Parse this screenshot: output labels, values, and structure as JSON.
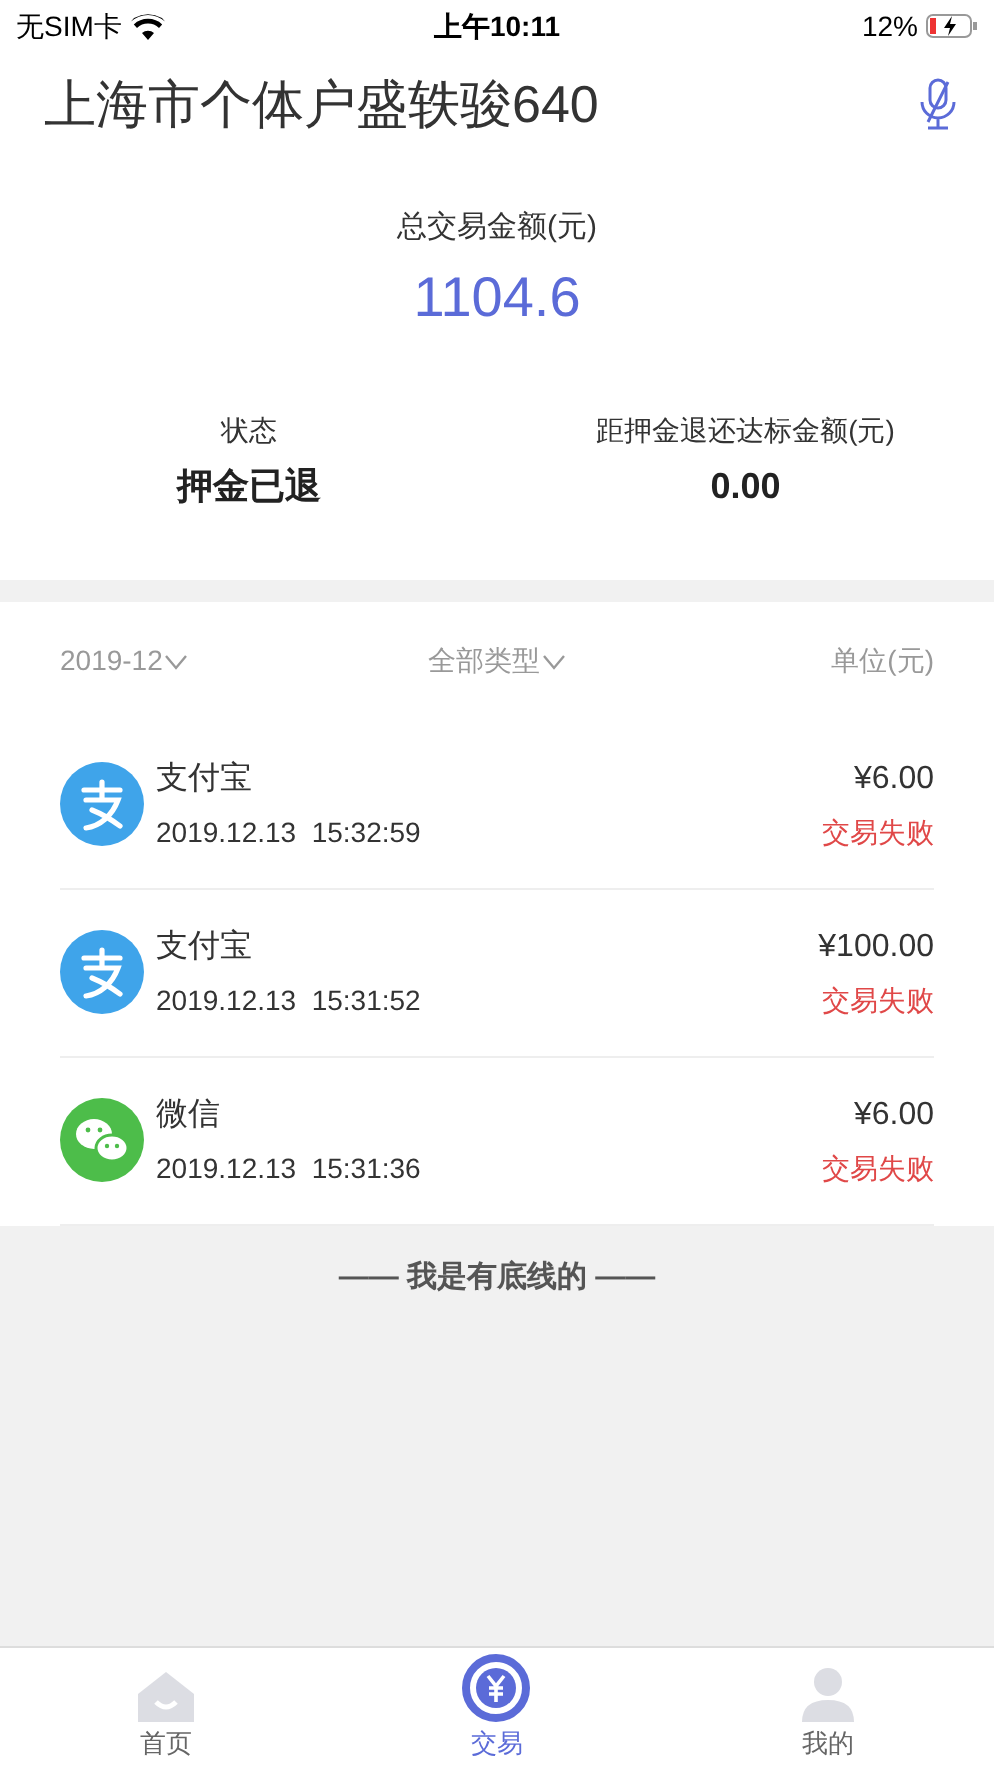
{
  "status_bar": {
    "carrier": "无SIM卡",
    "time": "上午10:11",
    "battery": "12%"
  },
  "header": {
    "title": "上海市个体户盛轶骏640"
  },
  "summary": {
    "total_label": "总交易金额(元)",
    "total_value": "1104.6",
    "stats": [
      {
        "label": "状态",
        "value": "押金已退"
      },
      {
        "label": "距押金退还达标金额(元)",
        "value": "0.00"
      }
    ]
  },
  "filters": {
    "month": "2019-12",
    "type": "全部类型",
    "unit": "单位(元)"
  },
  "transactions": [
    {
      "kind": "alipay",
      "name": "支付宝",
      "time": "2019.12.13  15:32:59",
      "amount": "¥6.00",
      "status": "交易失败"
    },
    {
      "kind": "alipay",
      "name": "支付宝",
      "time": "2019.12.13  15:31:52",
      "amount": "¥100.00",
      "status": "交易失败"
    },
    {
      "kind": "wechat",
      "name": "微信",
      "time": "2019.12.13  15:31:36",
      "amount": "¥6.00",
      "status": "交易失败"
    }
  ],
  "footer_note": "—— 我是有底线的 ——",
  "tab_bar": [
    {
      "kind": "home",
      "label": "首页",
      "selected": false
    },
    {
      "kind": "trade",
      "label": "交易",
      "selected": true
    },
    {
      "kind": "profile",
      "label": "我的",
      "selected": false
    }
  ]
}
